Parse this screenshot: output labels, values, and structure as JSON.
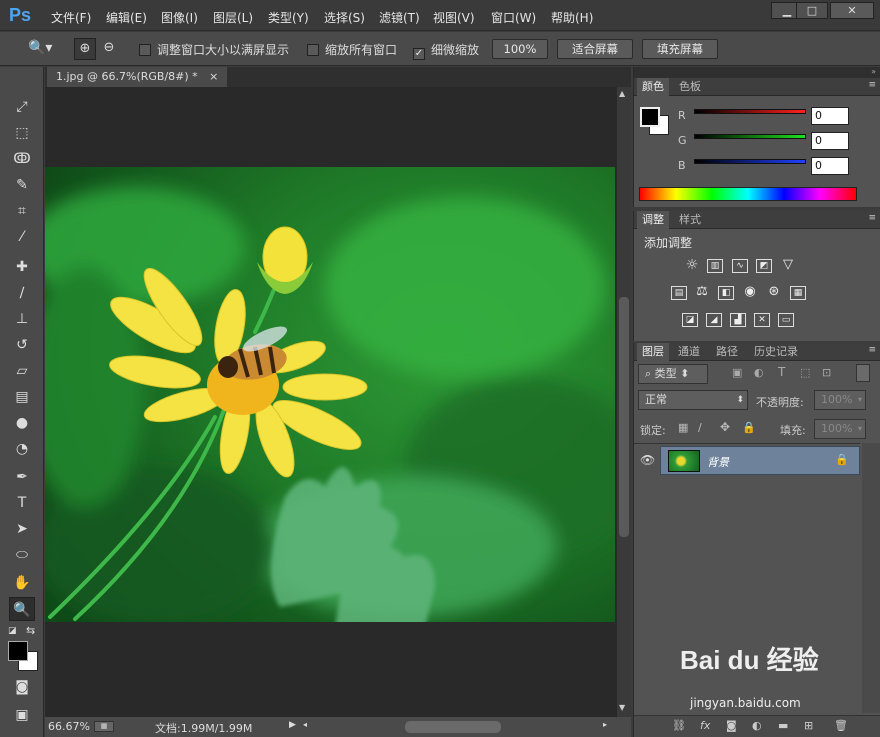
{
  "app": {
    "logo": "Ps"
  },
  "menu": [
    "文件(F)",
    "编辑(E)",
    "图像(I)",
    "图层(L)",
    "类型(Y)",
    "选择(S)",
    "滤镜(T)",
    "视图(V)",
    "窗口(W)",
    "帮助(H)"
  ],
  "window_controls": {
    "minimize": "▁",
    "maximize": "□",
    "close": "✕"
  },
  "options": {
    "resize_windows": "调整窗口大小以满屏显示",
    "zoom_all": "缩放所有窗口",
    "scrubby_zoom": "细微缩放",
    "percent_button": "100%",
    "fit_screen": "适合屏幕",
    "fill_screen": "填充屏幕"
  },
  "document": {
    "tab_title": "1.jpg @ 66.7%(RGB/8#) *",
    "tab_close": "×"
  },
  "status": {
    "zoom": "66.67%",
    "doc_info": "文档:1.99M/1.99M"
  },
  "color_panel": {
    "tabs": [
      "颜色",
      "色板"
    ],
    "channels": [
      {
        "label": "R",
        "value": "0",
        "color": "#e02020"
      },
      {
        "label": "G",
        "value": "0",
        "color": "#20c020"
      },
      {
        "label": "B",
        "value": "0",
        "color": "#2040e0"
      }
    ]
  },
  "adjust_panel": {
    "tabs": [
      "调整",
      "样式"
    ],
    "title": "添加调整"
  },
  "layers_panel": {
    "tabs": [
      "图层",
      "通道",
      "路径",
      "历史记录"
    ],
    "kind_filter": "类型",
    "blend_mode": "正常",
    "opacity_label": "不透明度:",
    "opacity_value": "100%",
    "lock_label": "锁定:",
    "fill_label": "填充:",
    "fill_value": "100%",
    "layer_name": "背景"
  },
  "watermark": {
    "brand": "Bai du 经验",
    "url": "jingyan.baidu.com"
  }
}
